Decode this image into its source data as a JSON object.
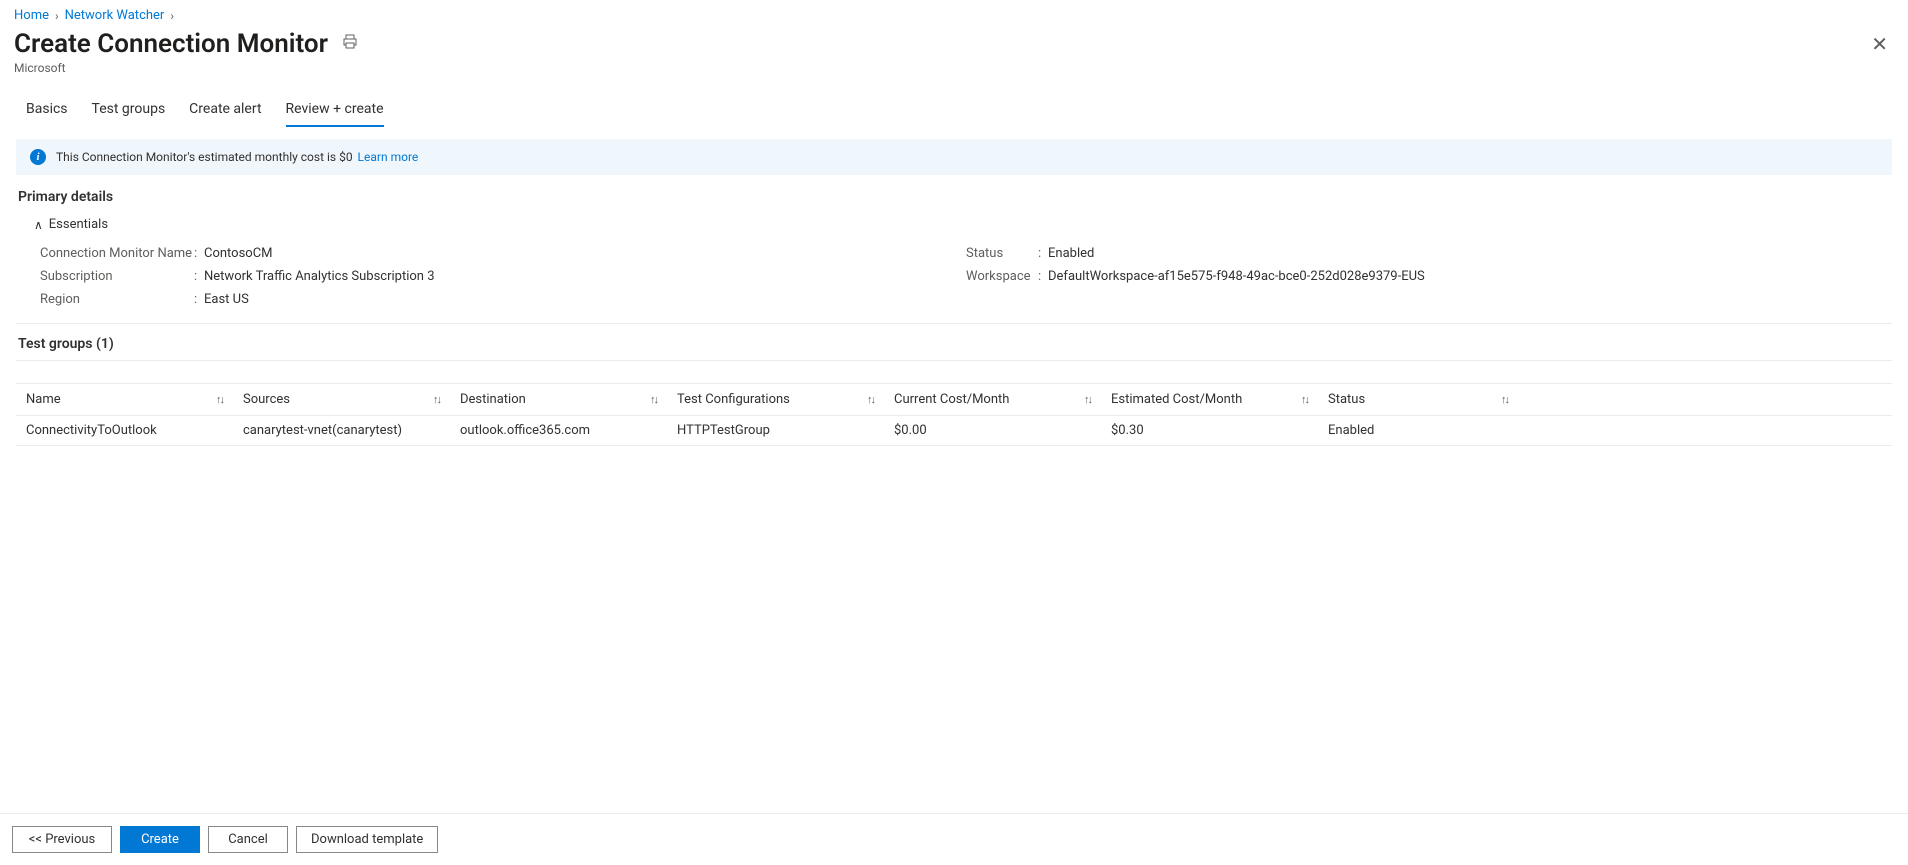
{
  "breadcrumb": {
    "home": "Home",
    "network_watcher": "Network Watcher"
  },
  "header": {
    "title": "Create Connection Monitor",
    "subtitle": "Microsoft"
  },
  "tabs": {
    "basics": "Basics",
    "test_groups": "Test groups",
    "create_alert": "Create alert",
    "review_create": "Review + create"
  },
  "banner": {
    "text": "This Connection Monitor's estimated monthly cost is $0",
    "link": "Learn more"
  },
  "sections": {
    "primary_details": "Primary details",
    "essentials": "Essentials",
    "test_groups_label": "Test groups (1)"
  },
  "details": {
    "left": {
      "cm_name_label": "Connection Monitor Name",
      "cm_name_value": "ContosoCM",
      "subscription_label": "Subscription",
      "subscription_value": "Network Traffic Analytics Subscription 3",
      "region_label": "Region",
      "region_value": "East US"
    },
    "right": {
      "status_label": "Status",
      "status_value": "Enabled",
      "workspace_label": "Workspace",
      "workspace_value": "DefaultWorkspace-af15e575-f948-49ac-bce0-252d028e9379-EUS"
    }
  },
  "table": {
    "headers": {
      "name": "Name",
      "sources": "Sources",
      "destination": "Destination",
      "test_configurations": "Test Configurations",
      "current_cost": "Current Cost/Month",
      "estimated_cost": "Estimated Cost/Month",
      "status": "Status"
    },
    "rows": [
      {
        "name": "ConnectivityToOutlook",
        "sources": "canarytest-vnet(canarytest)",
        "destination": "outlook.office365.com",
        "test_configurations": "HTTPTestGroup",
        "current_cost": "$0.00",
        "estimated_cost": "$0.30",
        "status": "Enabled"
      }
    ]
  },
  "footer": {
    "previous": "<<  Previous",
    "create": "Create",
    "cancel": "Cancel",
    "download": "Download template"
  }
}
